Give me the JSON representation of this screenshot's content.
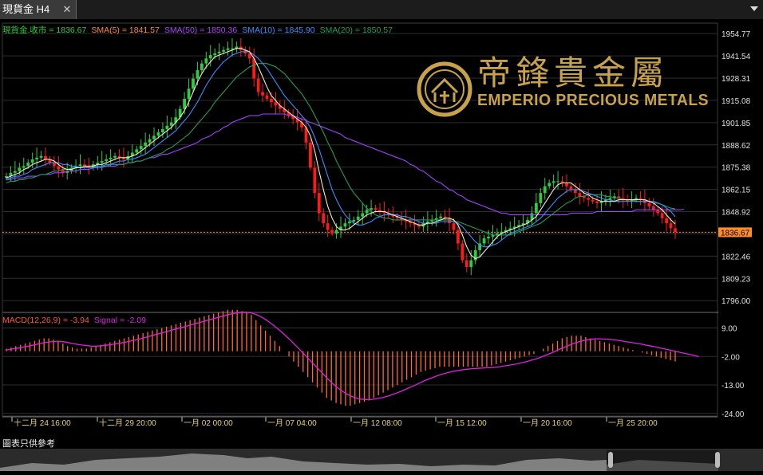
{
  "tab": {
    "title": "現貨金 H4",
    "close": "✕"
  },
  "logo": {
    "chinese": "帝鋒貴金屬",
    "english": "EMPERIO PRECIOUS METALS"
  },
  "disclaimer": "圖表只供參考",
  "colors": {
    "up": "#2ecc40",
    "down": "#ff1a1a",
    "sma5": "#f5e9c8",
    "sma10": "#3a8eff",
    "sma20": "#1f9e5a",
    "sma50": "#a040ff",
    "macd": "#ff6a2a",
    "signal": "#e020e0"
  },
  "chart_data": [
    {
      "type": "candlestick",
      "legend": [
        {
          "label": "現貨金.收市 = 1836.67",
          "color": "#2ecc40"
        },
        {
          "label": "SMA(5) = 1841.57",
          "color": "#ff8a2a"
        },
        {
          "label": "SMA(50) = 1850.36",
          "color": "#b040ff"
        },
        {
          "label": "SMA(10) = 1845.90",
          "color": "#3a8eff"
        },
        {
          "label": "SMA(20) = 1850.57",
          "color": "#1f9e5a"
        }
      ],
      "ylim": [
        1789,
        1961
      ],
      "y_ticks": [
        "1954.77",
        "1941.54",
        "1928.31",
        "1915.08",
        "1901.85",
        "1888.62",
        "1875.38",
        "1862.15",
        "1848.92",
        "1835.69",
        "1822.46",
        "1809.23",
        "1796.00"
      ],
      "last_price": "1836.67",
      "x_ticks": [
        "十二月 24 16:00",
        "十二月 29 20:00",
        "一月 02 00:00",
        "一月 07 04:00",
        "一月 12 08:00",
        "一月 15 12:00",
        "一月 20 16:00",
        "一月 25 20:00"
      ],
      "close": [
        1870,
        1872,
        1873,
        1875,
        1876,
        1878,
        1880,
        1881,
        1882,
        1880,
        1878,
        1876,
        1874,
        1872,
        1873,
        1875,
        1876,
        1877,
        1876,
        1875,
        1877,
        1878,
        1879,
        1880,
        1881,
        1882,
        1881,
        1880,
        1882,
        1884,
        1886,
        1888,
        1890,
        1892,
        1894,
        1896,
        1898,
        1900,
        1902,
        1905,
        1910,
        1916,
        1922,
        1928,
        1933,
        1937,
        1940,
        1942,
        1943,
        1944,
        1945,
        1946,
        1946,
        1947,
        1945,
        1943,
        1940,
        1928,
        1920,
        1918,
        1916,
        1914,
        1912,
        1910,
        1908,
        1906,
        1904,
        1902,
        1899,
        1890,
        1875,
        1860,
        1848,
        1842,
        1838,
        1836,
        1838,
        1840,
        1842,
        1843,
        1844,
        1846,
        1848,
        1850,
        1851,
        1850,
        1849,
        1848,
        1847,
        1846,
        1845,
        1844,
        1843,
        1842,
        1841,
        1840,
        1842,
        1843,
        1844,
        1845,
        1846,
        1845,
        1842,
        1838,
        1830,
        1820,
        1816,
        1820,
        1826,
        1830,
        1833,
        1834,
        1835,
        1836,
        1837,
        1838,
        1839,
        1840,
        1841,
        1842,
        1844,
        1848,
        1854,
        1860,
        1864,
        1866,
        1867,
        1867,
        1866,
        1864,
        1862,
        1860,
        1858,
        1857,
        1856,
        1855,
        1854,
        1855,
        1856,
        1857,
        1858,
        1857,
        1856,
        1855,
        1856,
        1857,
        1856,
        1854,
        1852,
        1850,
        1848,
        1845,
        1842,
        1839,
        1836.67
      ],
      "sma5": [
        1869,
        1870,
        1871,
        1872,
        1874,
        1875,
        1877,
        1878,
        1879,
        1880,
        1880,
        1879,
        1877,
        1875,
        1874,
        1874,
        1875,
        1875,
        1876,
        1876,
        1876,
        1877,
        1877,
        1878,
        1879,
        1880,
        1881,
        1881,
        1881,
        1882,
        1883,
        1885,
        1887,
        1889,
        1891,
        1893,
        1895,
        1897,
        1899,
        1902,
        1905,
        1909,
        1914,
        1920,
        1926,
        1931,
        1935,
        1938,
        1941,
        1942,
        1943,
        1944,
        1945,
        1946,
        1946,
        1945,
        1944,
        1940,
        1935,
        1929,
        1923,
        1918,
        1915,
        1912,
        1910,
        1908,
        1906,
        1904,
        1902,
        1899,
        1894,
        1885,
        1873,
        1862,
        1852,
        1845,
        1840,
        1838,
        1838,
        1839,
        1841,
        1843,
        1845,
        1847,
        1848,
        1849,
        1849,
        1849,
        1848,
        1847,
        1846,
        1845,
        1844,
        1843,
        1842,
        1841,
        1841,
        1842,
        1842,
        1843,
        1844,
        1845,
        1845,
        1844,
        1841,
        1835,
        1828,
        1823,
        1821,
        1822,
        1825,
        1828,
        1831,
        1834,
        1836,
        1837,
        1838,
        1839,
        1840,
        1841,
        1842,
        1844,
        1846,
        1850,
        1854,
        1858,
        1862,
        1865,
        1866,
        1866,
        1866,
        1864,
        1862,
        1860,
        1859,
        1857,
        1856,
        1855,
        1855,
        1855,
        1855,
        1856,
        1856,
        1856,
        1856,
        1856,
        1856,
        1856,
        1855,
        1854,
        1852,
        1850,
        1847,
        1844,
        1841.57
      ],
      "sma10": [
        1868,
        1869,
        1870,
        1870,
        1871,
        1872,
        1874,
        1875,
        1876,
        1877,
        1878,
        1878,
        1878,
        1877,
        1877,
        1876,
        1876,
        1875,
        1875,
        1875,
        1875,
        1876,
        1876,
        1877,
        1877,
        1878,
        1879,
        1879,
        1880,
        1880,
        1881,
        1882,
        1883,
        1885,
        1887,
        1889,
        1891,
        1893,
        1895,
        1897,
        1900,
        1903,
        1906,
        1910,
        1914,
        1919,
        1924,
        1928,
        1932,
        1935,
        1938,
        1940,
        1942,
        1943,
        1944,
        1944,
        1944,
        1942,
        1940,
        1937,
        1934,
        1930,
        1926,
        1922,
        1918,
        1915,
        1912,
        1909,
        1906,
        1903,
        1899,
        1893,
        1886,
        1878,
        1870,
        1862,
        1856,
        1851,
        1847,
        1844,
        1842,
        1841,
        1841,
        1842,
        1843,
        1845,
        1846,
        1847,
        1847,
        1847,
        1847,
        1846,
        1846,
        1845,
        1844,
        1843,
        1842,
        1842,
        1842,
        1842,
        1843,
        1843,
        1843,
        1843,
        1842,
        1840,
        1837,
        1834,
        1831,
        1829,
        1828,
        1828,
        1829,
        1830,
        1832,
        1834,
        1836,
        1837,
        1838,
        1839,
        1840,
        1841,
        1843,
        1845,
        1848,
        1851,
        1854,
        1857,
        1859,
        1861,
        1862,
        1862,
        1862,
        1861,
        1860,
        1859,
        1858,
        1857,
        1856,
        1856,
        1855,
        1855,
        1855,
        1855,
        1855,
        1855,
        1855,
        1855,
        1855,
        1855,
        1854,
        1853,
        1851,
        1849,
        1845.9
      ],
      "sma20": [
        1866,
        1867,
        1867,
        1868,
        1868,
        1869,
        1869,
        1870,
        1871,
        1871,
        1872,
        1873,
        1873,
        1874,
        1874,
        1875,
        1875,
        1875,
        1875,
        1876,
        1876,
        1876,
        1876,
        1876,
        1877,
        1877,
        1877,
        1877,
        1878,
        1878,
        1879,
        1879,
        1880,
        1881,
        1882,
        1883,
        1884,
        1886,
        1887,
        1889,
        1891,
        1893,
        1895,
        1898,
        1901,
        1904,
        1907,
        1910,
        1914,
        1917,
        1920,
        1923,
        1926,
        1929,
        1931,
        1933,
        1935,
        1936,
        1937,
        1937,
        1937,
        1936,
        1935,
        1933,
        1931,
        1928,
        1925,
        1922,
        1919,
        1915,
        1911,
        1906,
        1901,
        1896,
        1890,
        1885,
        1879,
        1874,
        1869,
        1864,
        1860,
        1857,
        1854,
        1851,
        1849,
        1847,
        1846,
        1845,
        1845,
        1844,
        1844,
        1844,
        1844,
        1844,
        1844,
        1844,
        1844,
        1844,
        1844,
        1844,
        1844,
        1844,
        1844,
        1843,
        1843,
        1842,
        1841,
        1840,
        1839,
        1838,
        1837,
        1836,
        1835,
        1835,
        1835,
        1835,
        1835,
        1836,
        1837,
        1838,
        1839,
        1840,
        1841,
        1842,
        1844,
        1846,
        1848,
        1850,
        1852,
        1854,
        1855,
        1857,
        1858,
        1858,
        1859,
        1859,
        1859,
        1859,
        1858,
        1858,
        1857,
        1857,
        1856,
        1856,
        1856,
        1855,
        1855,
        1855,
        1855,
        1854,
        1854,
        1853,
        1852,
        1851,
        1850.57
      ],
      "sma50": [
        1868,
        1868,
        1869,
        1869,
        1869,
        1870,
        1870,
        1870,
        1871,
        1871,
        1871,
        1872,
        1872,
        1872,
        1873,
        1873,
        1873,
        1874,
        1874,
        1874,
        1875,
        1875,
        1875,
        1876,
        1876,
        1876,
        1877,
        1877,
        1878,
        1878,
        1879,
        1879,
        1880,
        1881,
        1881,
        1882,
        1883,
        1883,
        1884,
        1885,
        1886,
        1887,
        1888,
        1889,
        1890,
        1892,
        1893,
        1894,
        1896,
        1897,
        1899,
        1900,
        1902,
        1903,
        1904,
        1905,
        1906,
        1906,
        1906,
        1907,
        1907,
        1907,
        1907,
        1907,
        1907,
        1906,
        1906,
        1905,
        1904,
        1903,
        1902,
        1901,
        1900,
        1899,
        1898,
        1897,
        1896,
        1895,
        1893,
        1892,
        1891,
        1890,
        1889,
        1888,
        1887,
        1886,
        1885,
        1884,
        1883,
        1882,
        1881,
        1880,
        1879,
        1877,
        1876,
        1874,
        1873,
        1871,
        1869,
        1867,
        1866,
        1864,
        1862,
        1861,
        1859,
        1858,
        1856,
        1855,
        1854,
        1853,
        1852,
        1851,
        1850,
        1849,
        1848,
        1848,
        1847,
        1847,
        1847,
        1847,
        1847,
        1847,
        1847,
        1847,
        1847,
        1847,
        1847,
        1847,
        1847,
        1847,
        1848,
        1848,
        1848,
        1848,
        1848,
        1848,
        1849,
        1849,
        1849,
        1849,
        1849,
        1849,
        1849,
        1849,
        1849,
        1850,
        1850,
        1850,
        1850,
        1850,
        1850,
        1850,
        1850,
        1850,
        1850,
        1850,
        1850.36
      ]
    },
    {
      "type": "bar",
      "legend": [
        {
          "label": "MACD(12,26,9) = -3.94",
          "color": "#ff5a2a"
        },
        {
          "label": "Signal = -2.09",
          "color": "#e020e0"
        }
      ],
      "ylim": [
        -25,
        15
      ],
      "y_ticks": [
        "9.00",
        "-2.00",
        "-13.00",
        "-24.00"
      ],
      "macd": [
        1,
        1.5,
        2,
        2.5,
        3,
        3.5,
        4,
        4.5,
        5,
        5,
        4.5,
        4,
        3,
        2,
        1.5,
        1,
        1,
        1,
        1.5,
        2,
        2.5,
        3,
        3.5,
        4,
        4.5,
        5,
        5.5,
        6,
        6.5,
        7,
        7.5,
        8,
        8.5,
        9,
        9.5,
        10,
        10.5,
        11,
        11.5,
        12,
        12.5,
        13,
        13.5,
        14,
        14.5,
        15,
        15.5,
        16,
        16,
        16,
        15.5,
        15,
        14,
        12,
        10,
        8,
        6,
        4,
        2,
        0,
        -2,
        -4,
        -6,
        -8,
        -10,
        -12,
        -14,
        -16,
        -18,
        -19,
        -20,
        -20.5,
        -21,
        -21,
        -20.5,
        -20,
        -19.5,
        -19,
        -18,
        -17,
        -16,
        -15,
        -14,
        -13,
        -12,
        -11,
        -10,
        -9,
        -8,
        -7.5,
        -7,
        -6.5,
        -6,
        -6,
        -6,
        -6,
        -6,
        -6,
        -6,
        -6,
        -6,
        -6,
        -6,
        -5.5,
        -5,
        -4.5,
        -4,
        -3.5,
        -3,
        -2.5,
        -2,
        -1.5,
        -1,
        0,
        1,
        2,
        3,
        4,
        5,
        5.5,
        6,
        6,
        6,
        5.5,
        5,
        4.5,
        4,
        3.5,
        3,
        2.5,
        2,
        1.5,
        1,
        0.5,
        0,
        -0.5,
        -1,
        -1.5,
        -2,
        -2.5,
        -3,
        -3.5,
        -3.94
      ],
      "signal": [
        0.5,
        0.8,
        1.1,
        1.4,
        1.8,
        2.1,
        2.5,
        2.9,
        3.3,
        3.6,
        3.8,
        3.9,
        3.7,
        3.4,
        3.0,
        2.7,
        2.4,
        2.2,
        2.0,
        2.0,
        2.1,
        2.3,
        2.5,
        2.8,
        3.1,
        3.4,
        3.8,
        4.2,
        4.6,
        5.1,
        5.6,
        6.1,
        6.6,
        7.1,
        7.6,
        8.1,
        8.6,
        9.1,
        9.6,
        10.1,
        10.6,
        11.1,
        11.6,
        12.1,
        12.6,
        13.1,
        13.6,
        14.1,
        14.5,
        14.8,
        15.0,
        15.0,
        14.8,
        14.2,
        13.4,
        12.3,
        11.0,
        9.6,
        8.1,
        6.5,
        4.8,
        3.0,
        1.2,
        -0.7,
        -2.6,
        -4.5,
        -6.4,
        -8.3,
        -10.2,
        -12.0,
        -13.6,
        -15.0,
        -16.2,
        -17.2,
        -17.9,
        -18.4,
        -18.6,
        -18.7,
        -18.5,
        -18.2,
        -17.8,
        -17.3,
        -16.7,
        -16.0,
        -15.3,
        -14.5,
        -13.7,
        -12.9,
        -12.0,
        -11.2,
        -10.5,
        -9.8,
        -9.1,
        -8.6,
        -8.1,
        -7.7,
        -7.4,
        -7.1,
        -6.9,
        -6.7,
        -6.6,
        -6.5,
        -6.4,
        -6.3,
        -6.1,
        -5.9,
        -5.6,
        -5.3,
        -5.0,
        -4.6,
        -4.2,
        -3.7,
        -3.2,
        -2.6,
        -1.9,
        -1.2,
        -0.4,
        0.4,
        1.2,
        2.0,
        2.7,
        3.4,
        3.9,
        4.3,
        4.6,
        4.8,
        4.8,
        4.7,
        4.6,
        4.4,
        4.2,
        3.9,
        3.6,
        3.3,
        3.0,
        2.7,
        2.3,
        2.0,
        1.6,
        1.2,
        0.8,
        0.4,
        0,
        -0.4,
        -0.8,
        -1.2,
        -1.6,
        -2.09
      ]
    }
  ]
}
